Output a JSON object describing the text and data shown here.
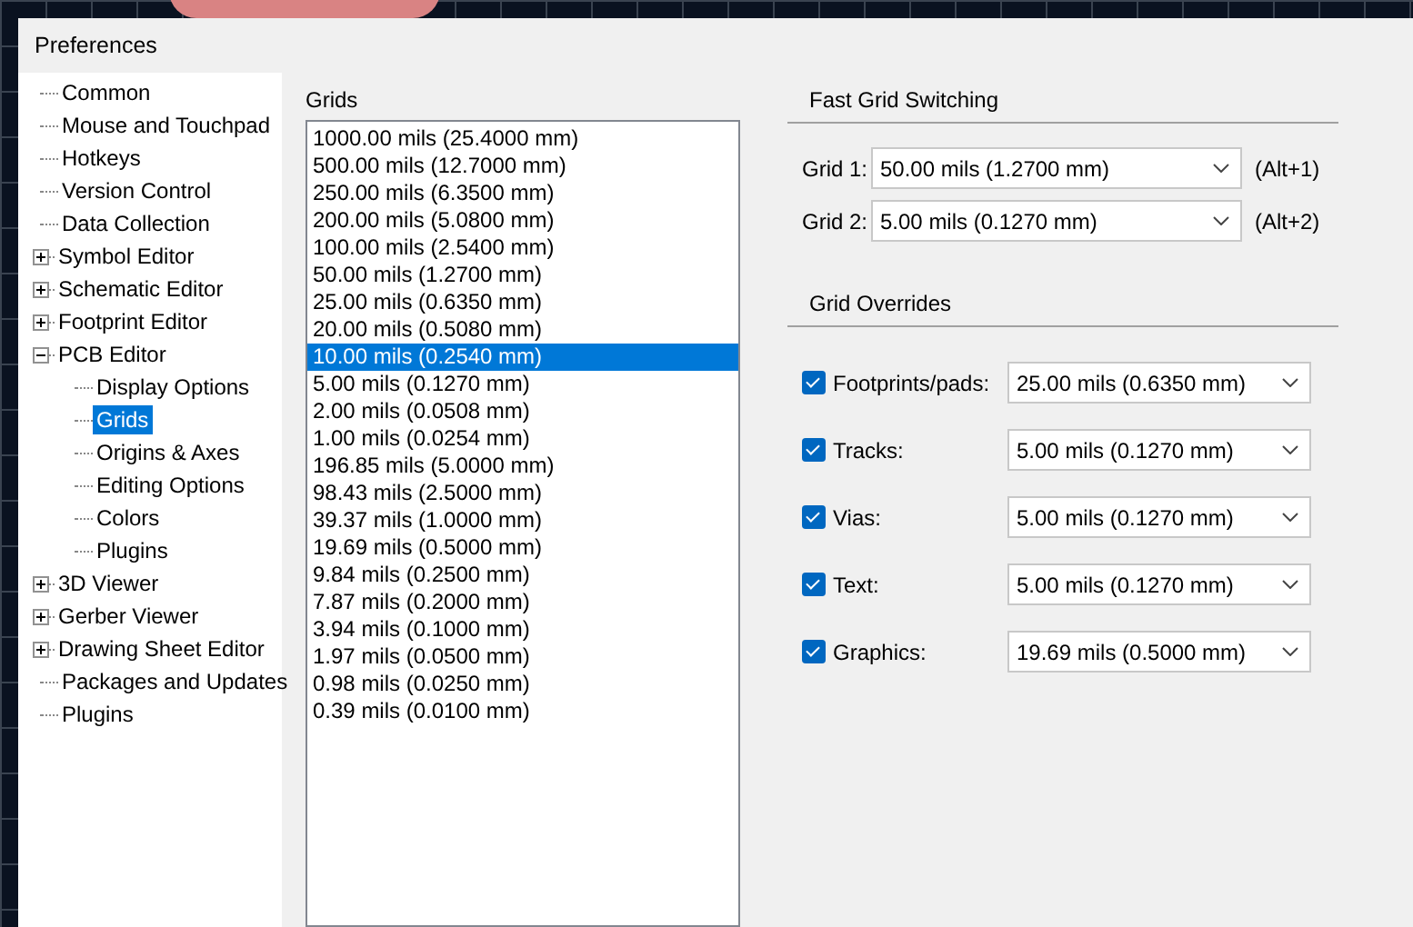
{
  "window": {
    "title": "Preferences"
  },
  "tree": [
    {
      "label": "Common",
      "selected": false
    },
    {
      "label": "Mouse and Touchpad",
      "selected": false
    },
    {
      "label": "Hotkeys",
      "selected": false
    },
    {
      "label": "Version Control",
      "selected": false
    },
    {
      "label": "Data Collection",
      "selected": false
    },
    {
      "label": "Symbol Editor",
      "selected": false,
      "expanded": false
    },
    {
      "label": "Schematic Editor",
      "selected": false,
      "expanded": false
    },
    {
      "label": "Footprint Editor",
      "selected": false,
      "expanded": false
    },
    {
      "label": "PCB Editor",
      "selected": false,
      "expanded": true,
      "children": [
        {
          "label": "Display Options",
          "selected": false
        },
        {
          "label": "Grids",
          "selected": true
        },
        {
          "label": "Origins & Axes",
          "selected": false
        },
        {
          "label": "Editing Options",
          "selected": false
        },
        {
          "label": "Colors",
          "selected": false
        },
        {
          "label": "Plugins",
          "selected": false
        }
      ]
    },
    {
      "label": "3D Viewer",
      "selected": false,
      "expanded": false
    },
    {
      "label": "Gerber Viewer",
      "selected": false,
      "expanded": false
    },
    {
      "label": "Drawing Sheet Editor",
      "selected": false,
      "expanded": false
    },
    {
      "label": "Packages and Updates",
      "selected": false
    },
    {
      "label": "Plugins",
      "selected": false
    }
  ],
  "grids": {
    "label": "Grids",
    "items": [
      {
        "text": "1000.00 mils (25.4000 mm)",
        "selected": false
      },
      {
        "text": "500.00 mils (12.7000 mm)",
        "selected": false
      },
      {
        "text": "250.00 mils (6.3500 mm)",
        "selected": false
      },
      {
        "text": "200.00 mils (5.0800 mm)",
        "selected": false
      },
      {
        "text": "100.00 mils (2.5400 mm)",
        "selected": false
      },
      {
        "text": "50.00 mils (1.2700 mm)",
        "selected": false
      },
      {
        "text": "25.00 mils (0.6350 mm)",
        "selected": false
      },
      {
        "text": "20.00 mils (0.5080 mm)",
        "selected": false
      },
      {
        "text": "10.00 mils (0.2540 mm)",
        "selected": true
      },
      {
        "text": "5.00 mils (0.1270 mm)",
        "selected": false
      },
      {
        "text": "2.00 mils (0.0508 mm)",
        "selected": false
      },
      {
        "text": "1.00 mils (0.0254 mm)",
        "selected": false
      },
      {
        "text": "196.85 mils (5.0000 mm)",
        "selected": false
      },
      {
        "text": "98.43 mils (2.5000 mm)",
        "selected": false
      },
      {
        "text": "39.37 mils (1.0000 mm)",
        "selected": false
      },
      {
        "text": "19.69 mils (0.5000 mm)",
        "selected": false
      },
      {
        "text": "9.84 mils (0.2500 mm)",
        "selected": false
      },
      {
        "text": "7.87 mils (0.2000 mm)",
        "selected": false
      },
      {
        "text": "3.94 mils (0.1000 mm)",
        "selected": false
      },
      {
        "text": "1.97 mils (0.0500 mm)",
        "selected": false
      },
      {
        "text": "0.98 mils (0.0250 mm)",
        "selected": false
      },
      {
        "text": "0.39 mils (0.0100 mm)",
        "selected": false
      }
    ]
  },
  "fast_grid_switching": {
    "title": "Fast Grid Switching",
    "rows": [
      {
        "label": "Grid 1:",
        "value": "50.00 mils (1.2700 mm)",
        "hotkey": "(Alt+1)"
      },
      {
        "label": "Grid 2:",
        "value": "5.00 mils (0.1270 mm)",
        "hotkey": "(Alt+2)"
      }
    ]
  },
  "grid_overrides": {
    "title": "Grid Overrides",
    "rows": [
      {
        "label": "Footprints/pads:",
        "checked": true,
        "value": "25.00 mils (0.6350 mm)"
      },
      {
        "label": "Tracks:",
        "checked": true,
        "value": "5.00 mils (0.1270 mm)"
      },
      {
        "label": "Vias:",
        "checked": true,
        "value": "5.00 mils (0.1270 mm)"
      },
      {
        "label": "Text:",
        "checked": true,
        "value": "5.00 mils (0.1270 mm)"
      },
      {
        "label": "Graphics:",
        "checked": true,
        "value": "19.69 mils (0.5000 mm)"
      }
    ]
  }
}
